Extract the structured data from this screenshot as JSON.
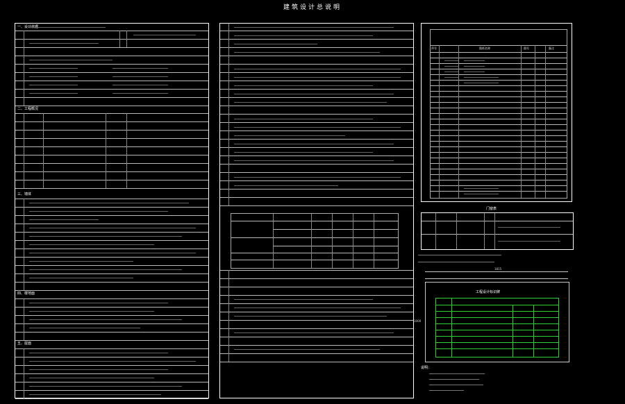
{
  "document": {
    "title": "建筑设计总说明"
  },
  "left_panel": {
    "sections": [
      {
        "label": "一、设计依据"
      },
      {
        "label": "二、工程概况"
      },
      {
        "label": "三、墙体"
      },
      {
        "label": "四、楼地面"
      },
      {
        "label": "五、屋面"
      }
    ]
  },
  "right_table": {
    "headers": [
      "序号",
      "图纸名称",
      "图号",
      "备注"
    ]
  },
  "window_table": {
    "title": "门窗表"
  },
  "green_table": {
    "title": "工程设计标识牌",
    "dim_top": "1815",
    "dim_left": "1000"
  },
  "notes": {
    "title": "说明："
  }
}
